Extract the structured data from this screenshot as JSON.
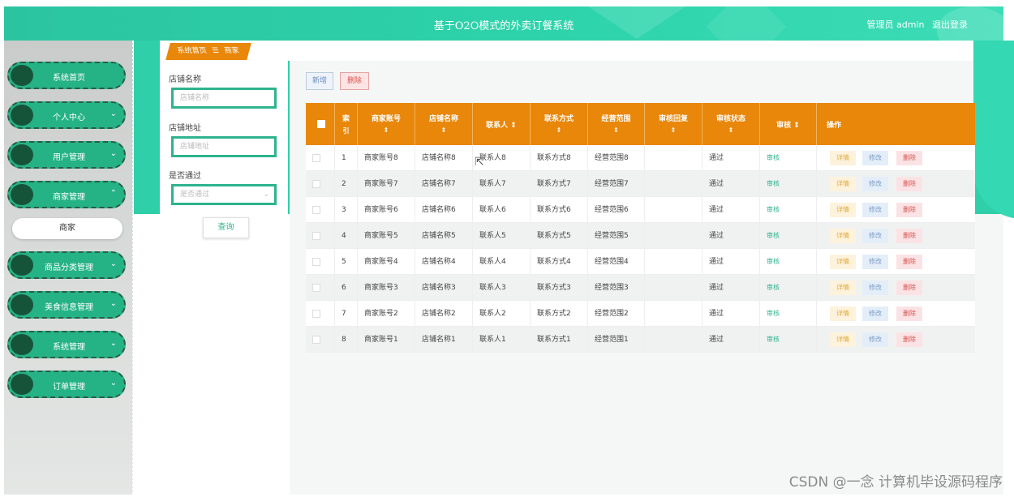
{
  "header": {
    "title": "基于O2O模式的外卖订餐系统",
    "user": "管理员 admin",
    "logout": "退出登录"
  },
  "sidebar": {
    "items": [
      {
        "label": "系统首页",
        "chev": ""
      },
      {
        "label": "个人中心",
        "chev": "⌄"
      },
      {
        "label": "用户管理",
        "chev": "⌄"
      },
      {
        "label": "商家管理",
        "chev": "⌃"
      },
      {
        "label": "商品分类管理",
        "chev": "⌄"
      },
      {
        "label": "美食信息管理",
        "chev": "⌄"
      },
      {
        "label": "系统管理",
        "chev": "⌄"
      },
      {
        "label": "订单管理",
        "chev": "⌄"
      }
    ],
    "subitem": "商家"
  },
  "breadcrumb": {
    "home": "系统首页",
    "sep": "☰",
    "current": "商家"
  },
  "filter": {
    "name_label": "店铺名称",
    "name_placeholder": "店铺名称",
    "address_label": "店铺地址",
    "address_placeholder": "店铺地址",
    "pass_label": "是否通过",
    "pass_placeholder": "是否通过",
    "search": "查询"
  },
  "toolbar": {
    "add": "新增",
    "delete": "删除"
  },
  "table": {
    "columns": [
      {
        "t1": "索",
        "t2": "引"
      },
      {
        "t1": "商家账号",
        "t2": "⇕"
      },
      {
        "t1": "店铺名称",
        "t2": "⇕"
      },
      {
        "t1": "联系人 ⇕",
        "t2": ""
      },
      {
        "t1": "联系方式",
        "t2": "⇕"
      },
      {
        "t1": "经营范围",
        "t2": "⇕"
      },
      {
        "t1": "审核回复",
        "t2": "⇕"
      },
      {
        "t1": "审核状态",
        "t2": "⇕"
      },
      {
        "t1": "审核 ⇕",
        "t2": ""
      },
      {
        "t1": "操作",
        "t2": ""
      }
    ],
    "rows": [
      {
        "idx": "1",
        "account": "商家账号8",
        "shop": "店铺名称8",
        "contact": "联系人8",
        "phone": "联系方式8",
        "scope": "经营范围8",
        "reply": "",
        "status": "通过",
        "audit": "审核"
      },
      {
        "idx": "2",
        "account": "商家账号7",
        "shop": "店铺名称7",
        "contact": "联系人7",
        "phone": "联系方式7",
        "scope": "经营范围7",
        "reply": "",
        "status": "通过",
        "audit": "审核"
      },
      {
        "idx": "3",
        "account": "商家账号6",
        "shop": "店铺名称6",
        "contact": "联系人6",
        "phone": "联系方式6",
        "scope": "经营范围6",
        "reply": "",
        "status": "通过",
        "audit": "审核"
      },
      {
        "idx": "4",
        "account": "商家账号5",
        "shop": "店铺名称5",
        "contact": "联系人5",
        "phone": "联系方式5",
        "scope": "经营范围5",
        "reply": "",
        "status": "通过",
        "audit": "审核"
      },
      {
        "idx": "5",
        "account": "商家账号4",
        "shop": "店铺名称4",
        "contact": "联系人4",
        "phone": "联系方式4",
        "scope": "经营范围4",
        "reply": "",
        "status": "通过",
        "audit": "审核"
      },
      {
        "idx": "6",
        "account": "商家账号3",
        "shop": "店铺名称3",
        "contact": "联系人3",
        "phone": "联系方式3",
        "scope": "经营范围3",
        "reply": "",
        "status": "通过",
        "audit": "审核"
      },
      {
        "idx": "7",
        "account": "商家账号2",
        "shop": "店铺名称2",
        "contact": "联系人2",
        "phone": "联系方式2",
        "scope": "经营范围2",
        "reply": "",
        "status": "通过",
        "audit": "审核"
      },
      {
        "idx": "8",
        "account": "商家账号1",
        "shop": "店铺名称1",
        "contact": "联系人1",
        "phone": "联系方式1",
        "scope": "经营范围1",
        "reply": "",
        "status": "通过",
        "audit": "审核"
      }
    ],
    "ops": {
      "detail": "详情",
      "edit": "修改",
      "remove": "删除"
    }
  },
  "watermark": "CSDN @一念 计算机毕设源码程序",
  "colors": {
    "primary": "#2eb38e",
    "header": "#2dd3ab",
    "table_head": "#e8870a"
  }
}
